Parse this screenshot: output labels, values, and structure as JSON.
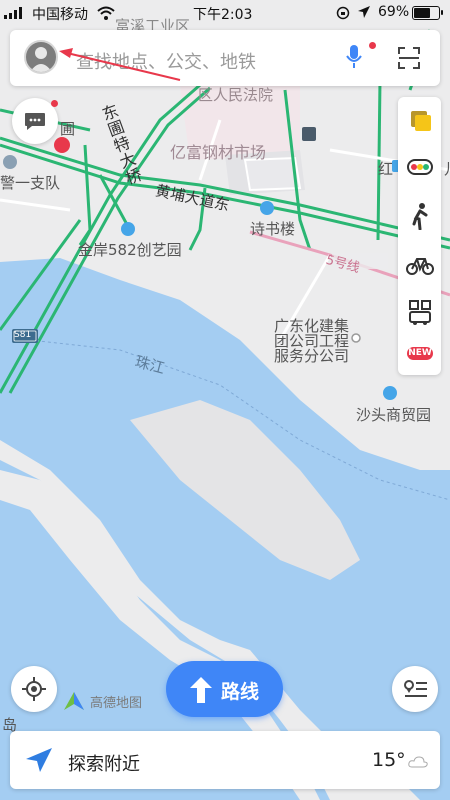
{
  "status_bar": {
    "carrier": "中国移动",
    "time": "下午2:03",
    "battery": "69%"
  },
  "search": {
    "placeholder": "查找地点、公交、地铁"
  },
  "map_labels": {
    "court": "区人民法院",
    "market": "亿富钢材市场",
    "bridge": "东圃特大桥",
    "road": "黄埔大道东",
    "bookhouse": "诗书楼",
    "park": "金岸582创艺园",
    "police": "警一支队",
    "line5": "5号线",
    "highway": "S81",
    "river": "珠江",
    "company": [
      "广东化建集",
      "团公司工程",
      "服务分公司"
    ],
    "shatou": "沙头商贸园",
    "partial_top": "富溪工业区",
    "partial_right": "红",
    "partial_left": "圃",
    "partial_bottom_left": "岛",
    "partial_right2": "儿"
  },
  "toolbar": {
    "new_badge": "NEW"
  },
  "logo": "高德地图",
  "route_button": {
    "label": "路线"
  },
  "bottom_bar": {
    "label": "探索附近",
    "temperature": "15°"
  },
  "colors": {
    "accent": "#3f86f7",
    "water": "#a4cdf2",
    "road_green": "#2bb673",
    "alert_red": "#e8384b"
  }
}
